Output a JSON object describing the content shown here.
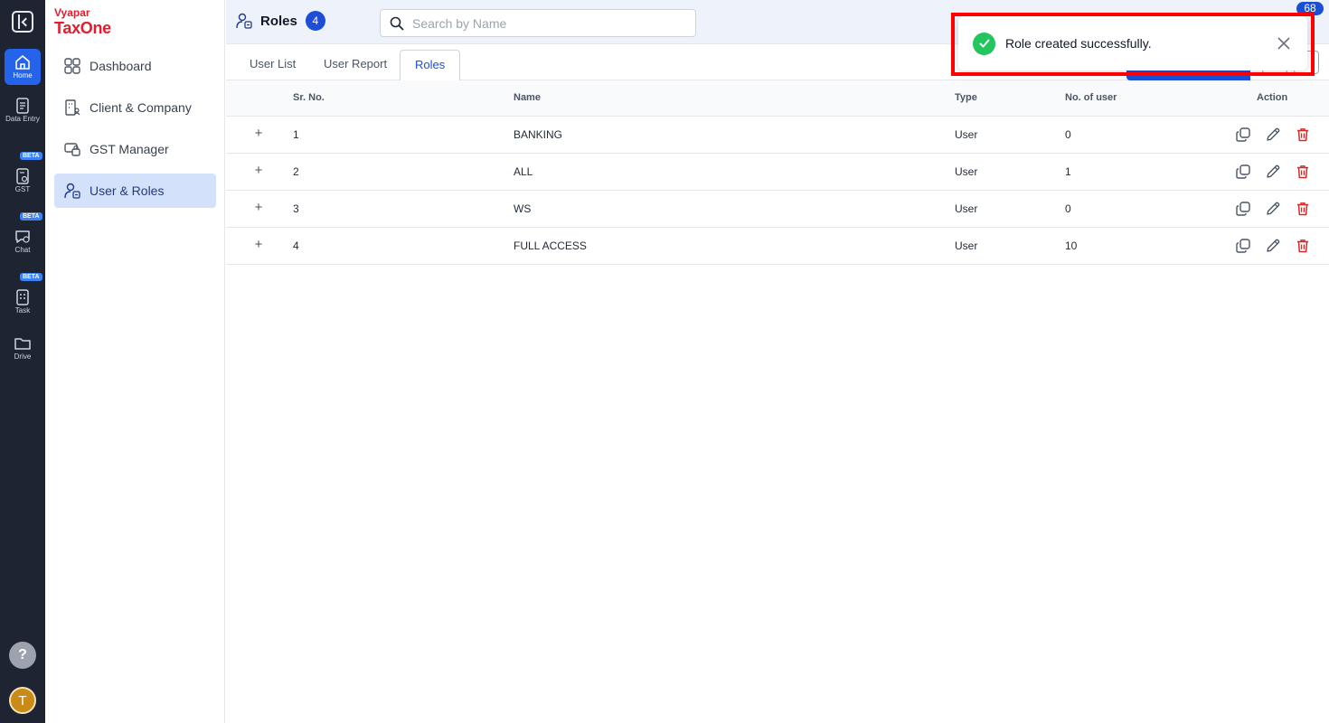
{
  "brand": {
    "top": "Vyapar",
    "main": "TaxOne"
  },
  "rail": {
    "items": [
      {
        "label": "Home",
        "icon": "home-icon"
      },
      {
        "label": "Data Entry",
        "icon": "data-entry-icon"
      },
      {
        "label": "GST",
        "icon": "gst-icon",
        "badge": "BETA"
      },
      {
        "label": "Chat",
        "icon": "chat-icon",
        "badge": "BETA"
      },
      {
        "label": "Task",
        "icon": "task-icon",
        "badge": "BETA"
      },
      {
        "label": "Drive",
        "icon": "folder-icon"
      }
    ],
    "help": "?",
    "avatar": "T"
  },
  "sidebar": {
    "items": [
      {
        "label": "Dashboard",
        "icon": "dashboard-icon"
      },
      {
        "label": "Client & Company",
        "icon": "building-icon"
      },
      {
        "label": "GST Manager",
        "icon": "gst-manager-icon"
      },
      {
        "label": "User & Roles",
        "icon": "user-roles-icon"
      }
    ]
  },
  "header": {
    "title": "Roles",
    "count": "4",
    "search_placeholder": "Search by Name",
    "notification_count": "68"
  },
  "tabs": [
    "User List",
    "User Report",
    "Roles"
  ],
  "table": {
    "columns": [
      "Sr. No.",
      "Name",
      "Type",
      "No. of user",
      "Action"
    ],
    "rows": [
      {
        "sr": "1",
        "name": "BANKING",
        "type": "User",
        "users": "0"
      },
      {
        "sr": "2",
        "name": "ALL",
        "type": "User",
        "users": "1"
      },
      {
        "sr": "3",
        "name": "WS",
        "type": "User",
        "users": "0"
      },
      {
        "sr": "4",
        "name": "FULL ACCESS",
        "type": "User",
        "users": "10"
      }
    ]
  },
  "toast": {
    "message": "Role created successfully."
  },
  "colors": {
    "accent": "#1d4ed8",
    "success": "#22c55e",
    "delete": "#dc2626",
    "brand": "#e11d2e"
  }
}
